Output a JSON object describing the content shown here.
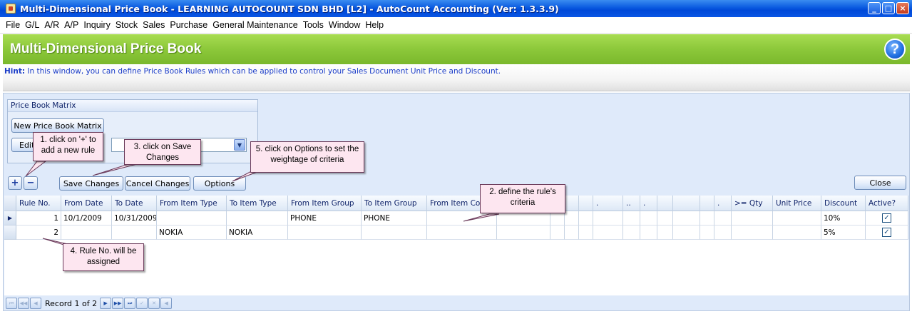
{
  "window": {
    "title": "Multi-Dimensional Price Book - LEARNING AUTOCOUNT SDN BHD [L2] - AutoCount Accounting (Ver: 1.3.3.9)",
    "minimize": "_",
    "maximize": "□",
    "close": "×"
  },
  "menu": [
    "File",
    "G/L",
    "A/R",
    "A/P",
    "Inquiry",
    "Stock",
    "Sales",
    "Purchase",
    "General Maintenance",
    "Tools",
    "Window",
    "Help"
  ],
  "header": {
    "title": "Multi-Dimensional Price Book",
    "help": "?"
  },
  "hint": {
    "label": "Hint:",
    "text": " In this window, you can define Price Book Rules which can be applied to control your Sales Document Unit Price and Discount."
  },
  "matrix": {
    "group_title": "Price Book Matrix",
    "new_button": "New Price Book Matrix",
    "edit_button": "Edit",
    "selected": "",
    "combo_arrow": "▼"
  },
  "toolbar": {
    "add": "+",
    "remove": "−",
    "save": "Save Changes",
    "cancel": "Cancel Changes",
    "options": "Options",
    "close": "Close"
  },
  "grid": {
    "columns": [
      "Rule No.",
      "From Date",
      "To Date",
      "From Item Type",
      "To Item Type",
      "From Item Group",
      "To Item Group",
      "From Item Code",
      "",
      "",
      "",
      "",
      ".",
      "..",
      ".",
      "",
      "",
      "",
      ".",
      ">= Qty",
      "Unit Price",
      "Discount",
      "Active?"
    ],
    "rows": [
      {
        "indicator": "▶",
        "cells": [
          "1",
          "10/1/2009",
          "10/31/2009",
          "",
          "",
          "PHONE",
          "PHONE",
          "",
          "",
          "",
          "",
          "",
          "",
          "",
          "",
          "",
          "",
          "",
          "",
          "",
          "",
          "10%"
        ],
        "active": "✓"
      },
      {
        "indicator": "",
        "cells": [
          "2",
          "",
          "",
          "NOKIA",
          "NOKIA",
          "",
          "",
          "",
          "",
          "",
          "",
          "",
          "",
          "",
          "",
          "",
          "",
          "",
          "",
          "",
          "",
          "5%"
        ],
        "active": "✓"
      }
    ]
  },
  "navigator": {
    "first": "⏮",
    "prev_page": "◀◀",
    "prev": "◀",
    "record_text": "Record 1 of 2",
    "next": "▶",
    "next_page": "▶▶",
    "last": "⏭",
    "append": "✓",
    "delete": "✕",
    "scroll": "◀"
  },
  "callouts": {
    "c1": "1. click on '+' to add a new rule",
    "c2": "2. define the rule's criteria",
    "c3": "3. click on Save Changes",
    "c4": "4. Rule No. will be assigned",
    "c5": "5. click on Options to set the weightage of criteria"
  }
}
